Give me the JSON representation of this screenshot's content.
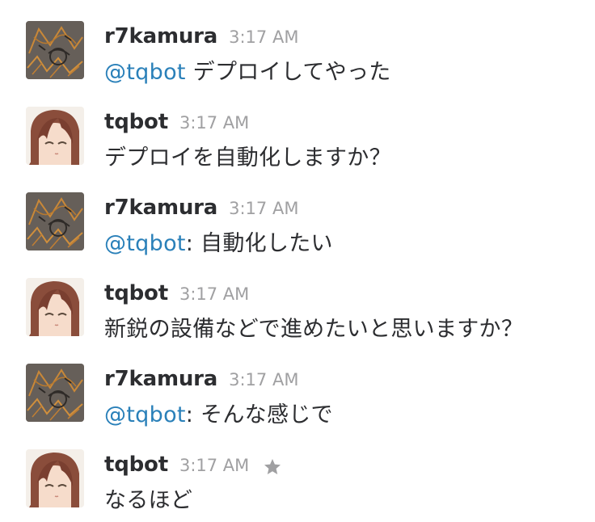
{
  "messages": [
    {
      "user": "r7kamura",
      "avatar_icon": "r7kamura-avatar",
      "time": "3:17 AM",
      "mention": "@tqbot",
      "text": " デプロイしてやった",
      "starred": false
    },
    {
      "user": "tqbot",
      "avatar_icon": "tqbot-avatar",
      "time": "3:17 AM",
      "mention": "",
      "text": "デプロイを自動化しますか？",
      "starred": false
    },
    {
      "user": "r7kamura",
      "avatar_icon": "r7kamura-avatar",
      "time": "3:17 AM",
      "mention": "@tqbot",
      "text": ": 自動化したい",
      "starred": false
    },
    {
      "user": "tqbot",
      "avatar_icon": "tqbot-avatar",
      "time": "3:17 AM",
      "mention": "",
      "text": "新鋭の設備などで進めたいと思いますか？",
      "starred": false
    },
    {
      "user": "r7kamura",
      "avatar_icon": "r7kamura-avatar",
      "time": "3:17 AM",
      "mention": "@tqbot",
      "text": ": そんな感じで",
      "starred": false
    },
    {
      "user": "tqbot",
      "avatar_icon": "tqbot-avatar",
      "time": "3:17 AM",
      "mention": "",
      "text": "なるほど",
      "starred": true
    }
  ],
  "colors": {
    "mention": "#2a80b9",
    "username": "#2c2d30",
    "timestamp": "#a0a0a2",
    "star": "#a0a0a2"
  }
}
